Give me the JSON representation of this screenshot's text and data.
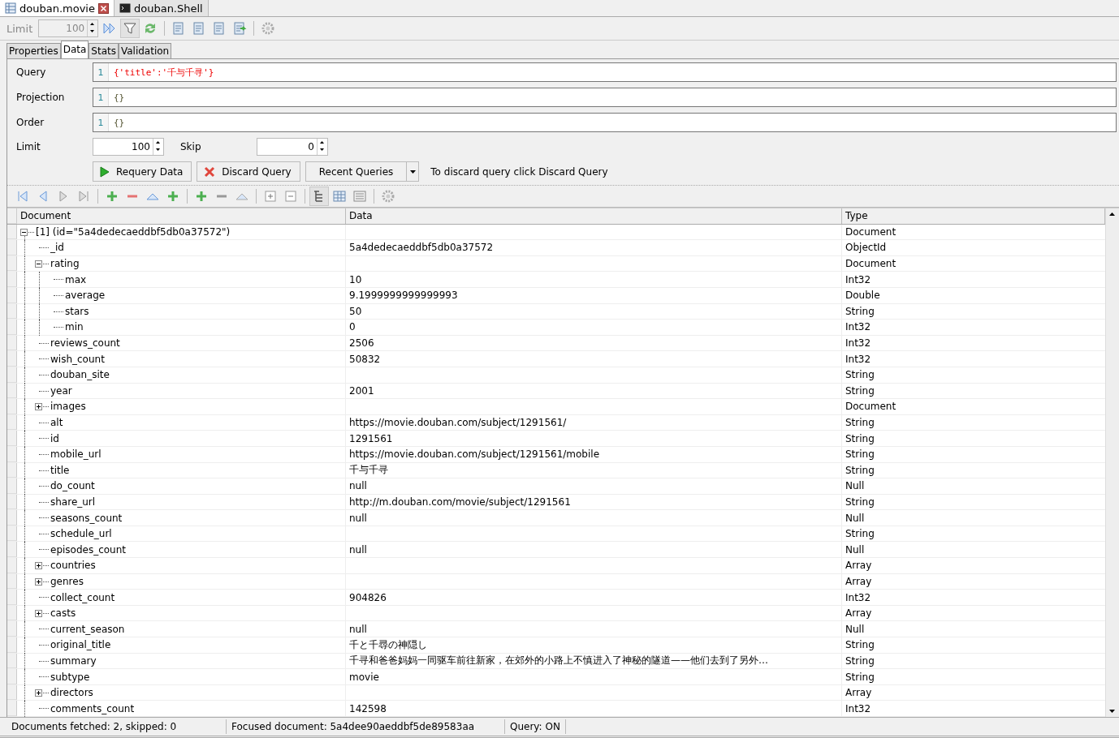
{
  "document_tabs": [
    {
      "label": "douban.movie",
      "selected": true,
      "kind": "table"
    },
    {
      "label": "douban.Shell",
      "selected": false,
      "kind": "shell"
    }
  ],
  "toolbar": {
    "limit_label": "Limit",
    "limit_value": "100"
  },
  "tabs": [
    {
      "label": "Properties",
      "selected": false
    },
    {
      "label": "Data",
      "selected": true
    },
    {
      "label": "Stats",
      "selected": false
    },
    {
      "label": "Validation",
      "selected": false
    }
  ],
  "query_form": {
    "editors": [
      {
        "label": "Query",
        "line": "1",
        "text": "{'title':'千与千寻'}",
        "kind": "error"
      },
      {
        "label": "Projection",
        "line": "1",
        "text": "{}",
        "kind": "ok"
      },
      {
        "label": "Order",
        "line": "1",
        "text": "{}",
        "kind": "ok"
      }
    ],
    "limit": {
      "label": "Limit",
      "value": "100"
    },
    "skip": {
      "label": "Skip",
      "value": "0"
    },
    "requery_button": "Requery Data",
    "discard_button": "Discard Query",
    "recent_button": "Recent Queries",
    "hint": "To discard query click Discard Query"
  },
  "table": {
    "columns": [
      "Document",
      "Data",
      "Type"
    ],
    "rows": [
      {
        "name": "[1] (id=\"5a4dedecaeddbf5db0a37572\")",
        "type": "Document",
        "expanded": true,
        "children": [
          {
            "name": "_id",
            "data": "5a4dedecaeddbf5db0a37572",
            "type": "ObjectId"
          },
          {
            "name": "rating",
            "type": "Document",
            "expanded": true,
            "children": [
              {
                "name": "max",
                "data": "10",
                "type": "Int32"
              },
              {
                "name": "average",
                "data": "9.1999999999999993",
                "type": "Double"
              },
              {
                "name": "stars",
                "data": "50",
                "type": "String"
              },
              {
                "name": "min",
                "data": "0",
                "type": "Int32"
              }
            ]
          },
          {
            "name": "reviews_count",
            "data": "2506",
            "type": "Int32"
          },
          {
            "name": "wish_count",
            "data": "50832",
            "type": "Int32"
          },
          {
            "name": "douban_site",
            "type": "String"
          },
          {
            "name": "year",
            "data": "2001",
            "type": "String"
          },
          {
            "name": "images",
            "type": "Document",
            "expanded": false
          },
          {
            "name": "alt",
            "data": "https://movie.douban.com/subject/1291561/",
            "type": "String"
          },
          {
            "name": "id",
            "data": "1291561",
            "type": "String"
          },
          {
            "name": "mobile_url",
            "data": "https://movie.douban.com/subject/1291561/mobile",
            "type": "String"
          },
          {
            "name": "title",
            "data": "千与千寻",
            "type": "String"
          },
          {
            "name": "do_count",
            "data": "null",
            "type": "Null"
          },
          {
            "name": "share_url",
            "data": "http://m.douban.com/movie/subject/1291561",
            "type": "String"
          },
          {
            "name": "seasons_count",
            "data": "null",
            "type": "Null"
          },
          {
            "name": "schedule_url",
            "type": "String"
          },
          {
            "name": "episodes_count",
            "data": "null",
            "type": "Null"
          },
          {
            "name": "countries",
            "type": "Array",
            "expanded": false
          },
          {
            "name": "genres",
            "type": "Array",
            "expanded": false
          },
          {
            "name": "collect_count",
            "data": "904826",
            "type": "Int32"
          },
          {
            "name": "casts",
            "type": "Array",
            "expanded": false
          },
          {
            "name": "current_season",
            "data": "null",
            "type": "Null"
          },
          {
            "name": "original_title",
            "data": "千と千尋の神隠し",
            "type": "String"
          },
          {
            "name": "summary",
            "data": "千寻和爸爸妈妈一同驱车前往新家，在郊外的小路上不慎进入了神秘的隧道——他们去到了另外…",
            "type": "String"
          },
          {
            "name": "subtype",
            "data": "movie",
            "type": "String"
          },
          {
            "name": "directors",
            "type": "Array",
            "expanded": false
          },
          {
            "name": "comments_count",
            "data": "142598",
            "type": "Int32"
          }
        ]
      }
    ]
  },
  "status_bar": [
    "Documents fetched: 2, skipped: 0",
    "Focused document: 5a4dee90aeddbf5de89583aa",
    "Query: ON"
  ]
}
